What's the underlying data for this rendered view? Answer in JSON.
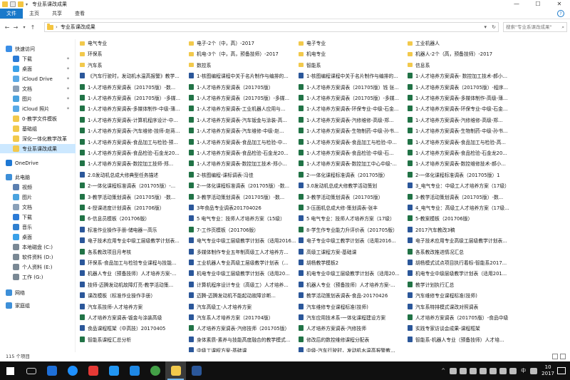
{
  "window": {
    "title": "专业系课改成果"
  },
  "ribbon": {
    "tabs": [
      "文件",
      "主页",
      "共享",
      "查看"
    ],
    "active_tab": "文件"
  },
  "address": {
    "path": "专业系课改成果",
    "search_placeholder": "搜索\"专业系课改成果\""
  },
  "sidebar": {
    "items": [
      {
        "label": "快速访问",
        "icon": "star-icon",
        "pinned": false
      },
      {
        "label": "下载",
        "icon": "download-icon",
        "pinned": true
      },
      {
        "label": "桌面",
        "icon": "desktop-icon",
        "pinned": true
      },
      {
        "label": "iCloud Drive",
        "icon": "cloud-icon",
        "pinned": true
      },
      {
        "label": "文档",
        "icon": "documents-icon",
        "pinned": true
      },
      {
        "label": "图片",
        "icon": "pictures-icon",
        "pinned": true
      },
      {
        "label": "iCloud 照片",
        "icon": "cloud-photos-icon",
        "pinned": true
      },
      {
        "label": "0-教学文件模板",
        "icon": "folder-icon",
        "pinned": false
      },
      {
        "label": "基础组",
        "icon": "folder-icon",
        "pinned": false
      },
      {
        "label": "深化一体化教学改革",
        "icon": "folder-icon",
        "pinned": false
      },
      {
        "label": "专业系课改成果",
        "icon": "folder-icon",
        "pinned": false
      },
      {
        "label": "OneDrive",
        "icon": "onedrive-icon",
        "pinned": false
      },
      {
        "label": "此电脑",
        "icon": "computer-icon",
        "pinned": false
      },
      {
        "label": "视频",
        "icon": "video-icon",
        "pinned": false
      },
      {
        "label": "图片",
        "icon": "pictures-icon",
        "pinned": false
      },
      {
        "label": "文档",
        "icon": "documents-icon",
        "pinned": false
      },
      {
        "label": "下载",
        "icon": "download-icon",
        "pinned": false
      },
      {
        "label": "音乐",
        "icon": "music-icon",
        "pinned": false
      },
      {
        "label": "桌面",
        "icon": "desktop-icon",
        "pinned": false
      },
      {
        "label": "本地磁盘 (C:)",
        "icon": "drive-icon",
        "pinned": false
      },
      {
        "label": "软件资料 (D:)",
        "icon": "drive-icon",
        "pinned": false
      },
      {
        "label": "个人资料 (E:)",
        "icon": "drive-icon",
        "pinned": false
      },
      {
        "label": "工作 (G:)",
        "icon": "drive-icon",
        "pinned": false
      },
      {
        "label": "网络",
        "icon": "network-icon",
        "pinned": false
      },
      {
        "label": "家庭组",
        "icon": "homegroup-icon",
        "pinned": false
      }
    ],
    "selected": "专业系课改成果"
  },
  "files": [
    [
      {
        "name": "电气专业",
        "type": "folder"
      },
      {
        "name": "环保系",
        "type": "folder"
      },
      {
        "name": "汽车系",
        "type": "folder"
      },
      {
        "name": "《汽车行驶时，发动机水温高报警》教学...",
        "type": "word"
      },
      {
        "name": "1-人才培养方案调表（201705版）-数...",
        "type": "excel"
      },
      {
        "name": "1-人才培养方案调表（201705版）-多媒...",
        "type": "excel"
      },
      {
        "name": "1-人才培养方案调表-多媒体制作-中级-薄...",
        "type": "excel"
      },
      {
        "name": "1-人才培养方案调表-计算机程序设计-中...",
        "type": "excel"
      },
      {
        "name": "1-人才培养方案调表-汽车维修-技师-赵蒋...",
        "type": "excel"
      },
      {
        "name": "1-人才培养方案调表-食品加工与检验-预...",
        "type": "excel"
      },
      {
        "name": "1-人才培养方案调表-食品检验-石金龙20...",
        "type": "excel"
      },
      {
        "name": "1-人才培养方案调表-数控加工技师-郑...",
        "type": "excel"
      },
      {
        "name": "2.0发动机总成大修典型任务描述",
        "type": "word"
      },
      {
        "name": "2-一体化课程标准调表（201705版）-...",
        "type": "excel"
      },
      {
        "name": "3-教学活动策划调表（201705版）-数...",
        "type": "excel"
      },
      {
        "name": "4-授课进度计划调表（201706版）",
        "type": "excel"
      },
      {
        "name": "6-信息员模板（201706版）",
        "type": "excel"
      },
      {
        "name": "标准作业操作手册-储电器—高乐",
        "type": "word"
      },
      {
        "name": "电子技术应用专业中级工层级教学计划表...",
        "type": "word"
      },
      {
        "name": "各系教改项目月考核",
        "type": "excel"
      },
      {
        "name": "环保系-食品加工与检验专业课程与技能...",
        "type": "word"
      },
      {
        "name": "机器人专业（预备技师）人才培养方案-...",
        "type": "word"
      },
      {
        "name": "技师-迈腾发动机故障灯亮-教学活动策...",
        "type": "word"
      },
      {
        "name": "课改模板（标准作业操作手册）",
        "type": "word"
      },
      {
        "name": "汽车系技师-人才培养方案",
        "type": "word"
      },
      {
        "name": "人才培养方案调表-钣金与涂装高级",
        "type": "excel"
      },
      {
        "name": "食品课程框架（中高技）20170405",
        "type": "word"
      },
      {
        "name": "智能系课程汇总分析",
        "type": "excel"
      }
    ],
    [
      {
        "name": "电子-2个（中，高）-2017",
        "type": "folder"
      },
      {
        "name": "机电-3个（中，高，预备技师）-2017",
        "type": "folder"
      },
      {
        "name": "数控系",
        "type": "folder"
      },
      {
        "name": "1-核图编程课程中关于名片制作与编排的...",
        "type": "word"
      },
      {
        "name": "1-人才培养方案调表（201705版）",
        "type": "excel"
      },
      {
        "name": "1-人才培养方案调表（201705版）-多媒...",
        "type": "excel"
      },
      {
        "name": "1-人才培养方案调表-工业机器人应用与...",
        "type": "excel"
      },
      {
        "name": "1-人才培养方案调表-汽车钣金与涂装-高...",
        "type": "excel"
      },
      {
        "name": "1-人才培养方案调表-汽车维修-中级-赵...",
        "type": "excel"
      },
      {
        "name": "1-人才培养方案调表-食品加工与检验-中...",
        "type": "excel"
      },
      {
        "name": "1-人才培养方案调表-食品检验-石金龙20...",
        "type": "excel"
      },
      {
        "name": "1-人才培养方案调表-数控加工技术-郑小...",
        "type": "excel"
      },
      {
        "name": "2-核图编程-课标调表-冯佳",
        "type": "excel"
      },
      {
        "name": "2-一体化课程标准调表（201705版）-数...",
        "type": "excel"
      },
      {
        "name": "3-教学活动策划调表（201705版）-数...",
        "type": "excel"
      },
      {
        "name": "3年食品专业调表201704026",
        "type": "word"
      },
      {
        "name": "5 电气专业：技师人才培养方案（15级）",
        "type": "word"
      },
      {
        "name": "7-工作页模板（201706版）",
        "type": "excel"
      },
      {
        "name": "电气专业中级工层级教学计划表（适用2016...",
        "type": "word"
      },
      {
        "name": "多媒体制作专业五年制高级工人才培养方...",
        "type": "word"
      },
      {
        "name": "工业机器人专业高级工层级教学计划表（...",
        "type": "word"
      },
      {
        "name": "机电专业中级工层级教学计划表（适用20...",
        "type": "word"
      },
      {
        "name": "计算机程序设计专业（高级工）人才培养...",
        "type": "word"
      },
      {
        "name": "迈腾-迈腾发动机不能起动故障诊断...",
        "type": "word"
      },
      {
        "name": "汽车高级工-人才培养方案",
        "type": "word"
      },
      {
        "name": "汽车系人才培养方案（201704版）",
        "type": "word"
      },
      {
        "name": "人才培养方案调表-汽修技师（201705版）",
        "type": "excel"
      },
      {
        "name": "身体素质-素养与技能高度融合的教学模式...",
        "type": "word"
      },
      {
        "name": "中级工课程方案-基础课",
        "type": "word"
      }
    ],
    [
      {
        "name": "电子专业",
        "type": "folder"
      },
      {
        "name": "机电专业",
        "type": "folder"
      },
      {
        "name": "智能系",
        "type": "folder"
      },
      {
        "name": "1-核图编程课程中关于名片制作与编排的...",
        "type": "word"
      },
      {
        "name": "1-人才培养方案调表（201705版）钱 张...",
        "type": "excel"
      },
      {
        "name": "1-人才培养方案调表（201705版）-多媒...",
        "type": "excel"
      },
      {
        "name": "1-人才培养方案调表-环保专业-中级-石金...",
        "type": "excel"
      },
      {
        "name": "1-人才培养方案调表-汽修维修-高级-郑...",
        "type": "excel"
      },
      {
        "name": "1-人才培养方案调表-生物制药-中级-孙书...",
        "type": "excel"
      },
      {
        "name": "1-人才培养方案调表-食品加工与检验-中...",
        "type": "excel"
      },
      {
        "name": "1-人才培养方案调表-食品检验-中级-石...",
        "type": "excel"
      },
      {
        "name": "1-人才培养方案调表-数控加工中心中级-...",
        "type": "excel"
      },
      {
        "name": "2-一体化课程标准调表（201705版）",
        "type": "excel"
      },
      {
        "name": "3.0发动机总成大修教学活动策划",
        "type": "word"
      },
      {
        "name": "3-教学活动策划调表（201705版）",
        "type": "excel"
      },
      {
        "name": "3-压面机总成大修-策划调表-张丰",
        "type": "excel"
      },
      {
        "name": "5 电气专业：技师人才培养方案（17级）",
        "type": "word"
      },
      {
        "name": "8-学生作专业能力升评价表（201705版）",
        "type": "excel"
      },
      {
        "name": "电子专业中级工教学计划表（适用2016...",
        "type": "word"
      },
      {
        "name": "高级工课程方案-基础课",
        "type": "word"
      },
      {
        "name": "胡杨教学模板2",
        "type": "word"
      },
      {
        "name": "机电专业中级工层级教学计划表（适用20...",
        "type": "word"
      },
      {
        "name": "机器人专业（预备技师）人才培养方案-...",
        "type": "word"
      },
      {
        "name": "教学活动策划表调表-食品-20170426",
        "type": "word"
      },
      {
        "name": "汽车维修专业课程标准(技师)",
        "type": "word"
      },
      {
        "name": "汽车应用技术系-一体化课程建设方案",
        "type": "word"
      },
      {
        "name": "人才培养方案调表-汽修技师",
        "type": "excel"
      },
      {
        "name": "修改后的数控维修课程分配表",
        "type": "excel"
      },
      {
        "name": "中级-汽车行驶时，发动机水温高报警教...",
        "type": "word"
      }
    ],
    [
      {
        "name": "工业机器人",
        "type": "folder"
      },
      {
        "name": "机器人-2个（高，预备技师）-2017",
        "type": "folder"
      },
      {
        "name": "信息系",
        "type": "folder"
      },
      {
        "name": "1-人才培养方案调表- 数控加工技术-郝小...",
        "type": "excel"
      },
      {
        "name": "1-人才培养方案调表（201705版）-程序...",
        "type": "excel"
      },
      {
        "name": "1-人才培养方案调表-多媒体制作-高级-薄...",
        "type": "excel"
      },
      {
        "name": "1-人才培养方案调表-环保专业-中级-石金...",
        "type": "excel"
      },
      {
        "name": "1-人才培养方案调表-汽修维修-高级-郑...",
        "type": "excel"
      },
      {
        "name": "1-人才培养方案调表-生物制药-中级-孙书...",
        "type": "excel"
      },
      {
        "name": "1-人才培养方案调表-食品加工与检验-高...",
        "type": "excel"
      },
      {
        "name": "1-人才培养方案调表-食品检验-石金龙20...",
        "type": "excel"
      },
      {
        "name": "1-人才培养方案调表-数控维修技术-郝小...",
        "type": "excel"
      },
      {
        "name": "2-一体化课程标准调表（201705版）1",
        "type": "excel"
      },
      {
        "name": "3_电气专业：中级工人才培养方案（17级）",
        "type": "word"
      },
      {
        "name": "3-教学活动策划调表（201705版）-数...",
        "type": "excel"
      },
      {
        "name": "4_电气专业：高级工人才培养方案（17级...",
        "type": "word"
      },
      {
        "name": "5-教案模板（201706版）",
        "type": "excel"
      },
      {
        "name": "2017汽车教改3稿",
        "type": "word"
      },
      {
        "name": "电子技术应用专业高级工层级教学计划表...",
        "type": "word"
      },
      {
        "name": "各系教改推进情况汇总",
        "type": "excel"
      },
      {
        "name": "胡杨模式试点项目执行着标-智能系2017...",
        "type": "word"
      },
      {
        "name": "机电专业中级层级教学计划表（适用201...",
        "type": "word"
      },
      {
        "name": "教学计划执行汇总",
        "type": "excel"
      },
      {
        "name": "汽车维修专业课程标准(技师)",
        "type": "word"
      },
      {
        "name": "汽车系特排模式课改对照调表",
        "type": "word"
      },
      {
        "name": "人才培养方案调表（201705版）-食品中级",
        "type": "excel"
      },
      {
        "name": "实践专家访谈会成果-课程框架",
        "type": "word"
      },
      {
        "name": "智能系-机器人专业（预备技师）人才培...",
        "type": "word"
      }
    ]
  ],
  "status": {
    "item_count": "115 个项目"
  },
  "taskbar": {
    "apps": [
      "start-icon",
      "task-view-icon",
      "app-k-icon",
      "ie-icon",
      "app-red-icon",
      "app-blue-icon",
      "app-star-icon",
      "app-green-icon",
      "file-explorer-icon",
      "word-icon"
    ],
    "active_app": "file-explorer-icon",
    "ime": "中",
    "clock_line1": "10",
    "clock_line2": "2017"
  }
}
